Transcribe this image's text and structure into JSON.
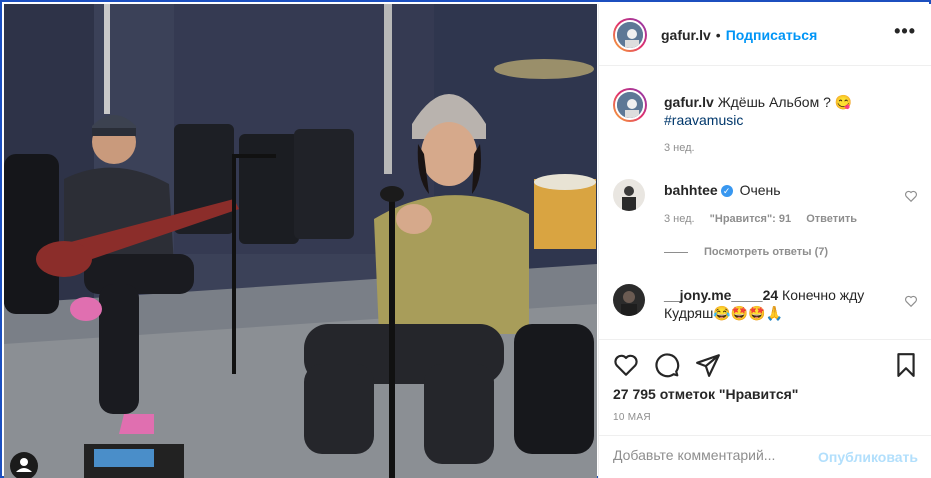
{
  "post": {
    "username": "gafur.lv",
    "separator": "•",
    "follow_label": "Подписаться",
    "more_label": "•••"
  },
  "caption": {
    "username": "gafur.lv",
    "text": "Ждёшь Альбом ? 😋",
    "hashtag": "#raavamusic",
    "time": "3 нед."
  },
  "comments": [
    {
      "username": "bahhtee",
      "verified": true,
      "text": "Очень",
      "time": "3 нед.",
      "likes": "\"Нравится\": 91",
      "reply_label": "Ответить",
      "view_replies": "Посмотреть ответы (7)"
    },
    {
      "username": "__jony.me____24",
      "text": "Конечно жду Кудряш😂🤩🤩🙏"
    }
  ],
  "engagement": {
    "likes": "27 795 отметок \"Нравится\"",
    "date": "10 МАЯ"
  },
  "add_comment": {
    "placeholder": "Добавьте комментарий...",
    "publish_label": "Опубликовать"
  },
  "icons": [
    "heart-icon",
    "comment-icon",
    "share-icon",
    "bookmark-icon",
    "more-icon",
    "verified-icon"
  ],
  "colors": {
    "accent": "#0095f6",
    "link": "#00376b",
    "muted": "#8e8e8e",
    "publish_disabled": "#b2dffc"
  }
}
